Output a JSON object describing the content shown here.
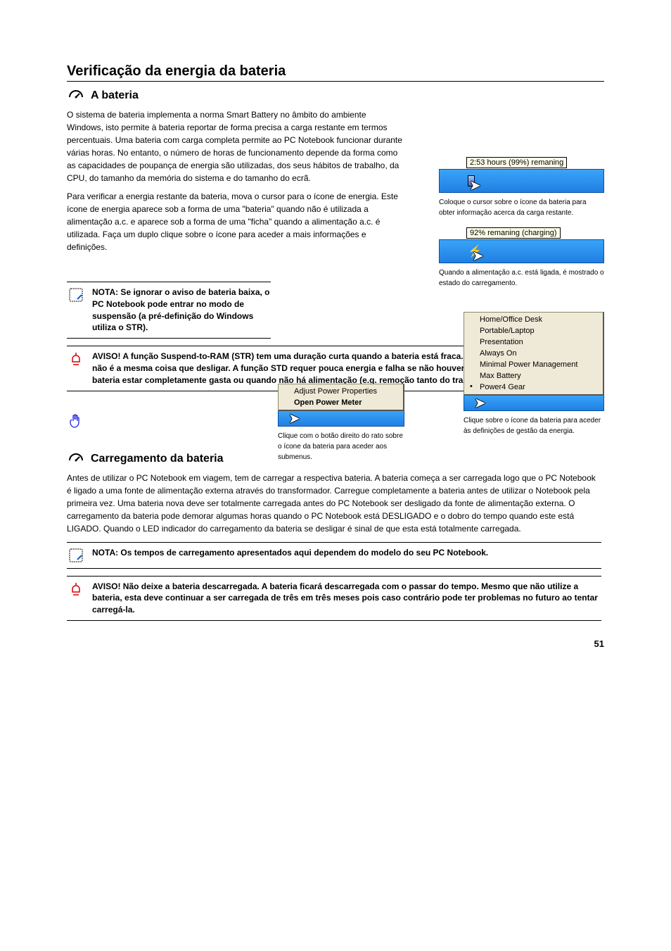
{
  "header": {
    "title": "Verificação da energia da bateria"
  },
  "intro": {
    "subtitle": "A bateria",
    "p1": "O sistema de bateria implementa a norma Smart Battery no âmbito do ambiente Windows, isto permite à bateria reportar de forma precisa a carga restante em termos percentuais. Uma bateria com carga completa permite ao PC Notebook funcionar durante várias horas. No entanto, o número de horas de funcionamento depende da forma como as capacidades de poupança de energia são utilizadas, dos seus hábitos de trabalho, da CPU, do tamanho da memória do sistema e do tamanho do ecrã.",
    "p2": "Para verificar a energia restante da bateria, mova o cursor para o ícone de energia. Este ícone de energia aparece sob a forma de uma \"bateria\" quando não é utilizada a alimentação a.c. e aparece sob a forma de uma \"ficha\" quando a alimentação a.c. é utilizada. Faça um duplo clique sobre o ícone para aceder a mais informações e definições."
  },
  "tooltips": {
    "remaining": "2:53 hours (99%) remaning",
    "charging": "92% remaning (charging)"
  },
  "captions": {
    "c1": "Coloque o cursor sobre o ícone da bateria para obter informação acerca da carga restante.",
    "c2": "Quando a alimentação a.c. está ligada, é mostrado o estado do carregamento.",
    "c3": "Clique sobre o ícone da bateria para aceder às definições de gestão da energia.",
    "c4": "Clique com o botão direito do rato sobre o ícone da bateria para aceder aos submenus."
  },
  "notes": {
    "n1": "NOTA: Se ignorar o aviso de bateria baixa, o PC Notebook pode entrar no modo de suspensão (a pré-definição do Windows utiliza o STR).",
    "n2": "AVISO! A função Suspend-to-RAM (STR) tem uma duração curta quando a bateria está fraca. A função Suspend-to-Disk (STD) não é a mesma coisa que desligar. A função STD requer pouca energia e falha se não houver energia disponível devido à bateria estar completamente gasta ou quando não há alimentação (e.g. remoção tanto do transformador como da bateria).",
    "n3": "NOTA: Os tempos de carregamento apresentados aqui dependem do modelo do seu PC Notebook.",
    "n4": "AVISO! Não deixe a bateria descarregada. A bateria ficará descarregada com o passar do tempo. Mesmo que não utilize a bateria, esta deve continuar a ser carregada de três em três meses pois caso contrário pode ter problemas no futuro ao tentar carregá-la."
  },
  "context_menu_left": {
    "items": [
      {
        "label": "Adjust Power Properties",
        "bold": false
      },
      {
        "label": "Open Power Meter",
        "bold": true
      }
    ]
  },
  "context_menu_right": {
    "items": [
      {
        "label": "Home/Office Desk"
      },
      {
        "label": "Portable/Laptop"
      },
      {
        "label": "Presentation"
      },
      {
        "label": "Always On"
      },
      {
        "label": "Minimal Power Management"
      },
      {
        "label": "Max Battery"
      },
      {
        "label": "Power4 Gear",
        "selected": true
      }
    ]
  },
  "charging": {
    "title": "Carregamento da bateria",
    "p1": "Antes de utilizar o PC Notebook em viagem, tem de carregar a respectiva bateria. A bateria começa a ser carregada logo que o PC Notebook é ligado a uma fonte de alimentação externa através do transformador. Carregue completamente a bateria antes de utilizar o Notebook pela primeira vez. Uma bateria nova deve ser totalmente carregada antes do PC Notebook ser desligado da fonte de alimentação externa. O carregamento da bateria pode demorar algumas horas quando o PC Notebook está DESLIGADO e o dobro do tempo quando este está LIGADO. Quando o LED indicador do carregamento da bateria se desligar é sinal de que esta está totalmente carregada."
  },
  "page_number": "51"
}
